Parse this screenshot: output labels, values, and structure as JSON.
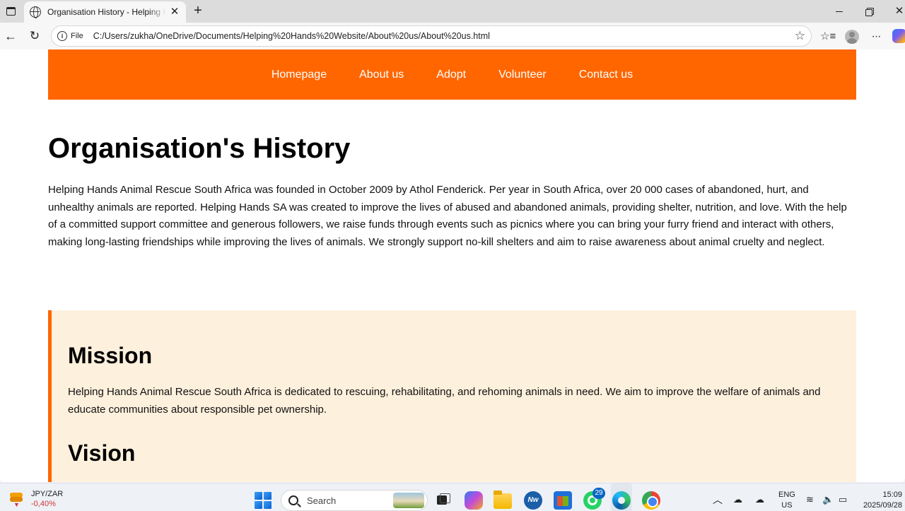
{
  "browser": {
    "tab": {
      "title": "Organisation History - Helping Hands"
    },
    "address": {
      "scheme_label": "File",
      "url": "C:/Users/zukha/OneDrive/Documents/Helping%20Hands%20Website/About%20us/About%20us.html"
    }
  },
  "site": {
    "nav": [
      "Homepage",
      "About us",
      "Adopt",
      "Volunteer",
      "Contact us"
    ],
    "accent_color": "#ff6600",
    "panel_color": "#fdf0dc",
    "title": "Organisation's History",
    "intro": "Helping Hands Animal Rescue South Africa was founded in October 2009 by Athol Fenderick. Per year in South Africa, over 20 000 cases of abandoned, hurt, and unhealthy animals are reported. Helping Hands SA was created to improve the lives of abused and abandoned animals, providing shelter, nutrition, and love. With the help of a committed support committee and generous followers, we raise funds through events such as picnics where you can bring your furry friend and interact with others, making long-lasting friendships while improving the lives of animals. We strongly support no-kill shelters and aim to raise awareness about animal cruelty and neglect.",
    "mission": {
      "heading": "Mission",
      "text": "Helping Hands Animal Rescue South Africa is dedicated to rescuing, rehabilitating, and rehoming animals in need. We aim to improve the welfare of animals and educate communities about responsible pet ownership."
    },
    "vision": {
      "heading": "Vision"
    }
  },
  "taskbar": {
    "widget": {
      "pair": "JPY/ZAR",
      "change": "-0,40%"
    },
    "search_label": "Search",
    "whatsapp_badge": "29",
    "lang": {
      "line1": "ENG",
      "line2": "US"
    },
    "clock": {
      "time": "15:09",
      "date": "2025/09/28"
    },
    "icons": [
      "start-icon",
      "search-icon",
      "task-view-icon",
      "copilot-icon",
      "file-explorer-icon",
      "notes-app-icon",
      "store-icon",
      "whatsapp-icon",
      "edge-icon",
      "chrome-icon",
      "chevron-up-icon",
      "onedrive-icon",
      "wifi-icon",
      "volume-icon",
      "battery-icon"
    ]
  }
}
